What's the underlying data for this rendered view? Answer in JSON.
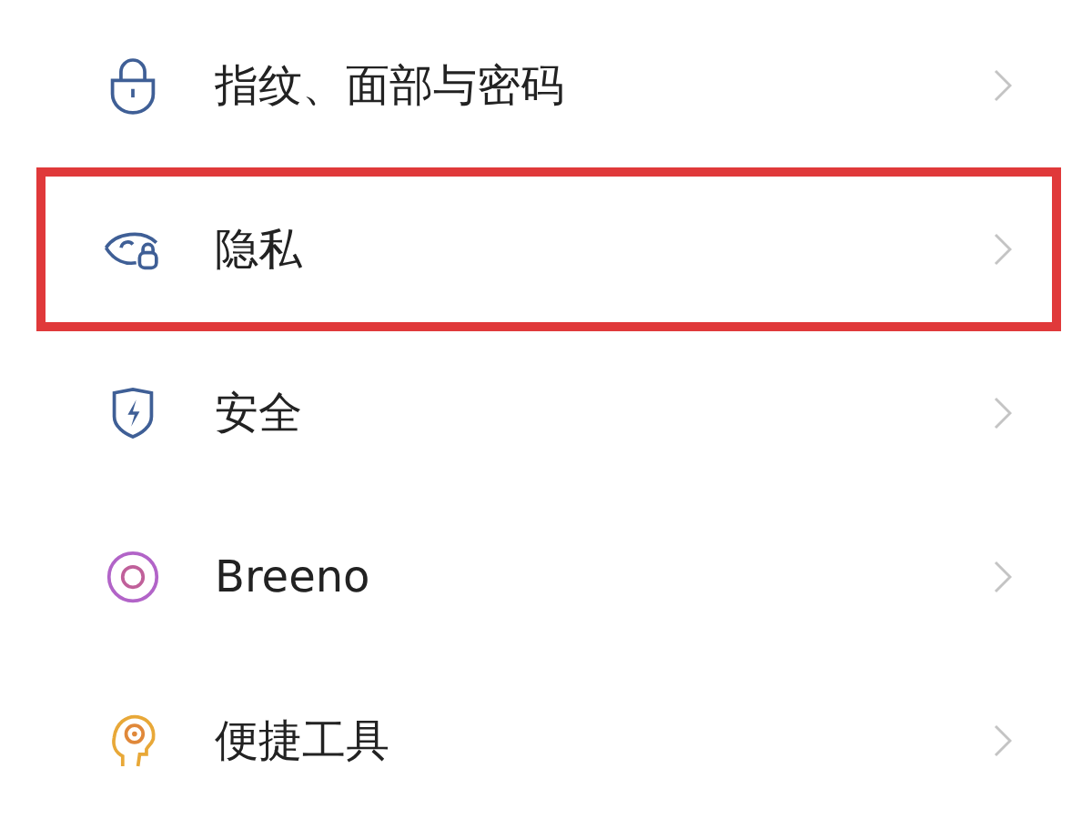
{
  "settings_items": [
    {
      "label": "指纹、面部与密码",
      "highlighted": false
    },
    {
      "label": "隐私",
      "highlighted": true
    },
    {
      "label": "安全",
      "highlighted": false
    },
    {
      "label": "Breeno",
      "highlighted": false
    },
    {
      "label": "便捷工具",
      "highlighted": false
    }
  ]
}
